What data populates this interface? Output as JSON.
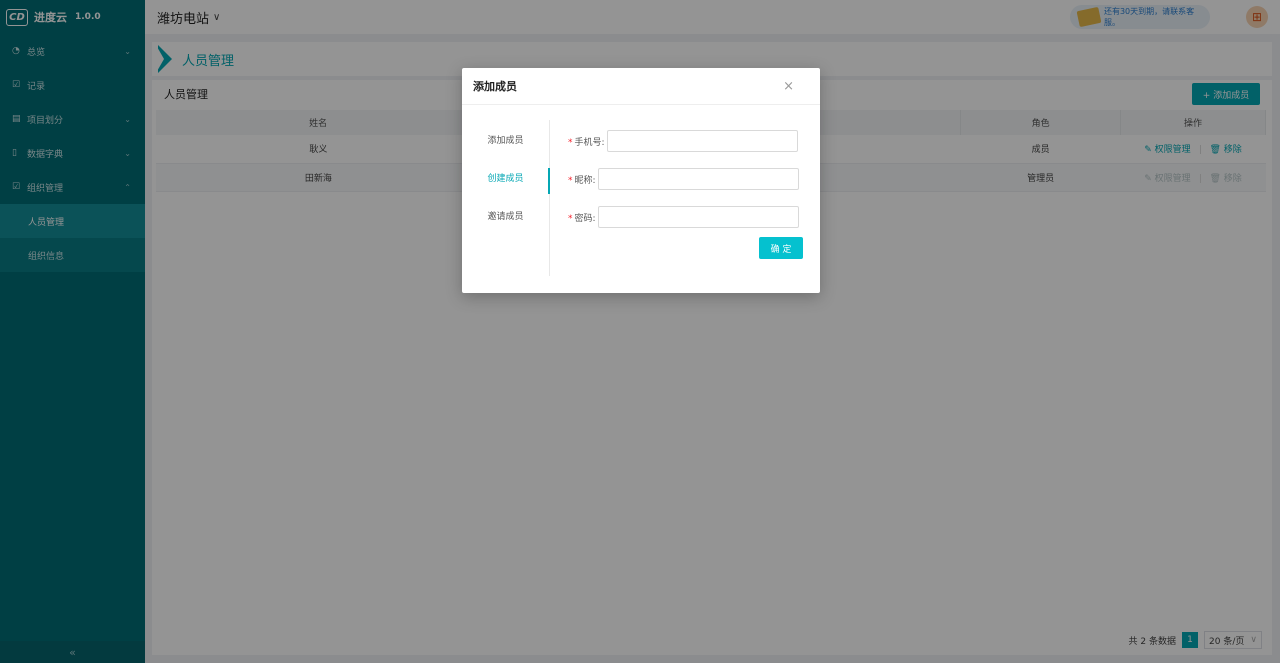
{
  "app": {
    "logo_mark": "CD",
    "name": "进度云",
    "version": "1.0.0"
  },
  "header": {
    "station": "潍坊电站",
    "notice": "还有30天到期，请联系客服。"
  },
  "sidebar": {
    "items": [
      {
        "label": "总览",
        "icon": "dashboard-icon"
      },
      {
        "label": "记录",
        "icon": "edit-icon"
      },
      {
        "label": "项目划分",
        "icon": "list-icon"
      },
      {
        "label": "数据字典",
        "icon": "book-icon"
      },
      {
        "label": "组织管理",
        "icon": "edit-icon"
      }
    ],
    "submenu": [
      {
        "label": "人员管理",
        "active": true
      },
      {
        "label": "组织信息",
        "active": false
      }
    ],
    "collapse_icon": "«"
  },
  "breadcrumb": {
    "title": "人员管理"
  },
  "panel": {
    "title": "人员管理",
    "add_button": "+ 添加成员",
    "columns": [
      "姓名",
      "",
      "角色",
      "操作"
    ],
    "rows": [
      {
        "name": "耿义",
        "role": "成员"
      },
      {
        "name": "田新海",
        "role": "管理员"
      }
    ],
    "op_perm": "权限管理",
    "op_remove": "移除"
  },
  "pagination": {
    "total_text": "共 2 条数据",
    "current_page": "1",
    "page_size": "20 条/页"
  },
  "modal": {
    "title": "添加成员",
    "close_icon": "×",
    "tabs": [
      {
        "label": "添加成员",
        "active": false
      },
      {
        "label": "创建成员",
        "active": true
      },
      {
        "label": "邀请成员",
        "active": false
      }
    ],
    "fields": {
      "phone_label": "手机号:",
      "nickname_label": "昵称:",
      "password_label": "密码:"
    },
    "confirm": "确 定"
  },
  "colors": {
    "accent": "#05a7b4",
    "sidebar": "#006d75",
    "required": "#f5222d"
  }
}
